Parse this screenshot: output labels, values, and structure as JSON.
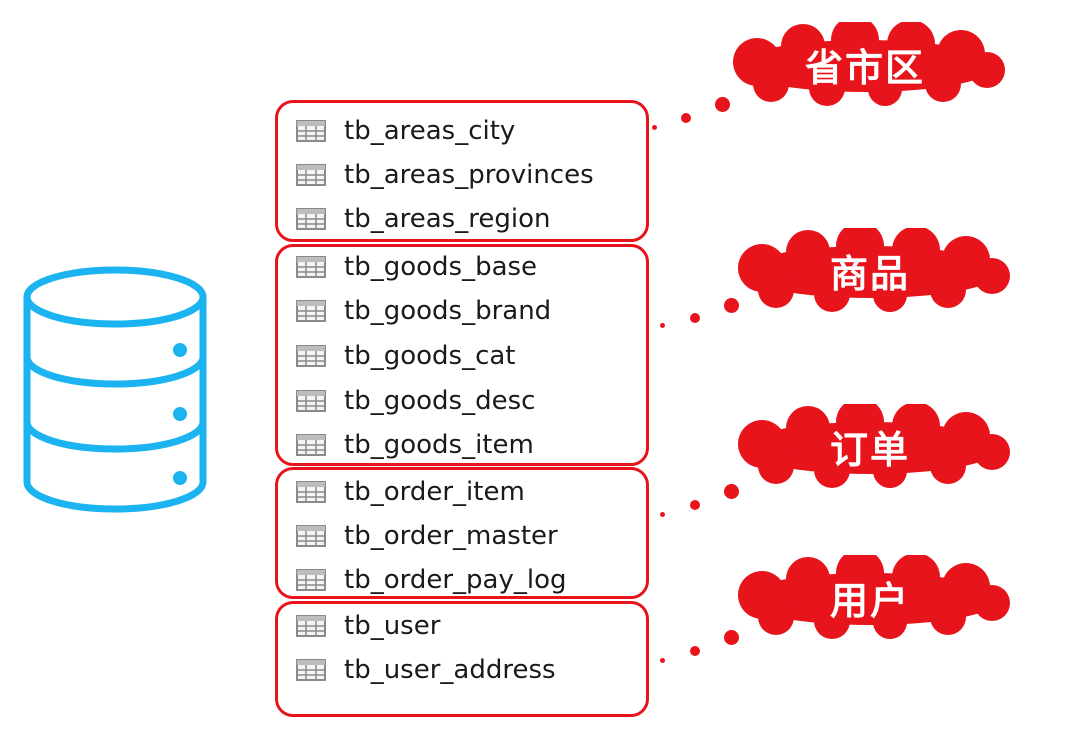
{
  "colors": {
    "accent": "#e8141c",
    "database": "#1cb4f0",
    "table_icon": "#8a8a8a",
    "text": "#1a1a1a"
  },
  "database": {
    "icon": "database-icon"
  },
  "groups": [
    {
      "cloud_label": "省市区",
      "tables": [
        "tb_areas_city",
        "tb_areas_provinces",
        "tb_areas_region"
      ]
    },
    {
      "cloud_label": "商品",
      "tables": [
        "tb_goods_base",
        "tb_goods_brand",
        "tb_goods_cat",
        "tb_goods_desc",
        "tb_goods_item"
      ]
    },
    {
      "cloud_label": "订单",
      "tables": [
        "tb_order_item",
        "tb_order_master",
        "tb_order_pay_log"
      ]
    },
    {
      "cloud_label": "用户",
      "tables": [
        "tb_user",
        "tb_user_address"
      ]
    }
  ]
}
